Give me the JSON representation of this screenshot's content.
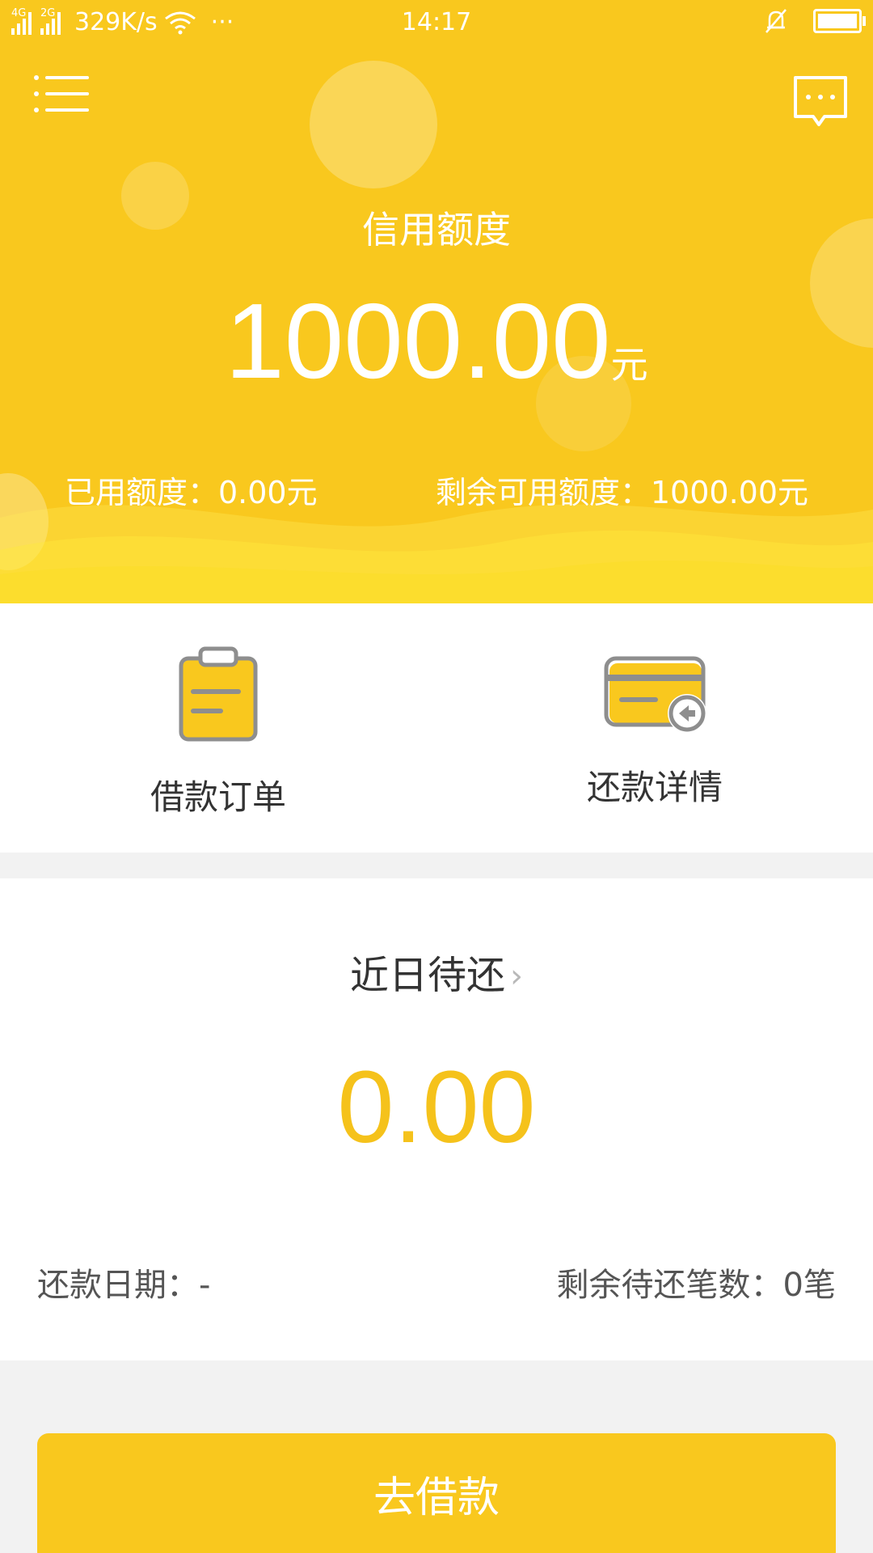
{
  "status_bar": {
    "net1": "4G",
    "net2": "2G",
    "speed": "329K/s",
    "more": "···",
    "time": "14:17"
  },
  "header": {
    "credit_label": "信用额度",
    "credit_amount": "1000.00",
    "credit_unit": "元",
    "used_quota": "已用额度：0.00元",
    "remaining_quota": "剩余可用额度：1000.00元"
  },
  "actions": {
    "loan_orders": "借款订单",
    "repay_details": "还款详情"
  },
  "due": {
    "title": "近日待还",
    "amount": "0.00",
    "repay_date": "还款日期：-",
    "remaining_count": "剩余待还笔数：0笔"
  },
  "primary_button": {
    "label": "去借款"
  },
  "colors": {
    "brand_yellow": "#f9c81e",
    "amount_yellow": "#f5c21b",
    "icon_gray": "#8e8e8e"
  },
  "icons": {
    "menu": "menu-icon",
    "message": "message-icon",
    "loan_orders": "clipboard-icon",
    "repay_details": "card-return-icon"
  }
}
